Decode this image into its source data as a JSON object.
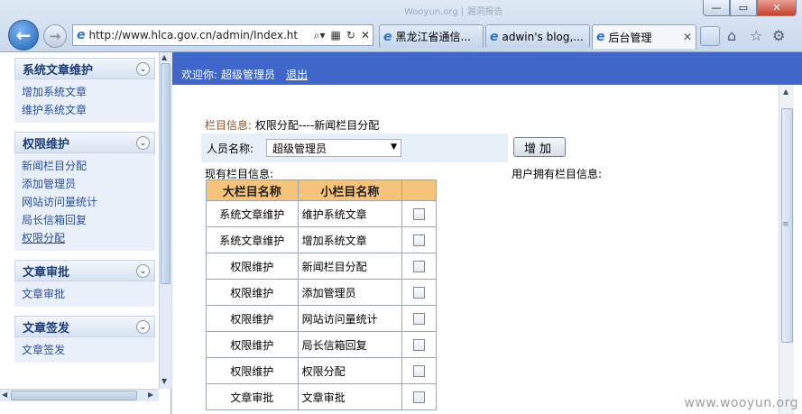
{
  "browser": {
    "address": "http://www.hlca.gov.cn/admin/Index.ht",
    "faint_tab": "Wooyun.org | 漏洞报告",
    "tabs": [
      {
        "label": "黑龙江省通信..."
      },
      {
        "label": "adwin's blog,..."
      },
      {
        "label": "后台管理",
        "active": true
      }
    ]
  },
  "sidebar": {
    "menus": [
      {
        "title": "系统文章维护",
        "items": [
          "增加系统文章",
          "维护系统文章"
        ]
      },
      {
        "title": "权限维护",
        "items": [
          "新闻栏目分配",
          "添加管理员",
          "网站访问量统计",
          "局长信箱回复",
          "权限分配"
        ]
      },
      {
        "title": "文章审批",
        "items": [
          "文章审批"
        ]
      },
      {
        "title": "文章签发",
        "items": [
          "文章签发"
        ]
      }
    ],
    "current_item": "权限分配"
  },
  "header": {
    "welcome": "欢迎你:",
    "user": "超级管理员",
    "logout": "退出"
  },
  "main": {
    "info_label": "栏目信息:",
    "info_value": "权限分配----新闻栏目分配",
    "person_label": "人员名称:",
    "person_selected": "超级管理员",
    "add_button": "增加",
    "existing_label": "现有栏目信息:",
    "user_label": "用户拥有栏目信息:",
    "table": {
      "headers": [
        "大栏目名称",
        "小栏目名称",
        ""
      ],
      "rows": [
        [
          "系统文章维护",
          "维护系统文章"
        ],
        [
          "系统文章维护",
          "增加系统文章"
        ],
        [
          "权限维护",
          "新闻栏目分配"
        ],
        [
          "权限维护",
          "添加管理员"
        ],
        [
          "权限维护",
          "网站访问量统计"
        ],
        [
          "权限维护",
          "局长信箱回复"
        ],
        [
          "权限维护",
          "权限分配"
        ],
        [
          "文章审批",
          "文章审批"
        ]
      ]
    }
  },
  "watermark": "www.wooyun.org",
  "colors": {
    "header_bar": "#3f67c9",
    "table_header": "#f5c47a",
    "info_label": "#9a4f1a"
  }
}
